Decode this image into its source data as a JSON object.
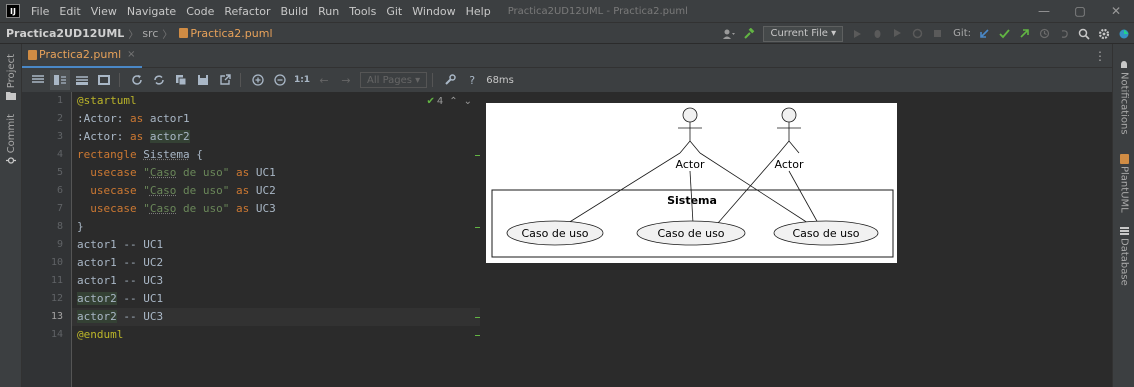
{
  "menubar": {
    "logo": "IJ",
    "items": [
      "File",
      "Edit",
      "View",
      "Navigate",
      "Code",
      "Refactor",
      "Build",
      "Run",
      "Tools",
      "Git",
      "Window",
      "Help"
    ],
    "window_title": "Practica2UD12UML - Practica2.puml",
    "controls": [
      "—",
      "▢",
      "✕"
    ]
  },
  "navbar": {
    "project": "Practica2UD12UML",
    "folder": "src",
    "file": "Practica2.puml",
    "run_config": "Current File",
    "git_label": "Git:"
  },
  "left_strip": {
    "project": "Project",
    "commit": "Commit"
  },
  "right_strip": {
    "notifications": "Notifications",
    "plantuml": "PlantUML",
    "database": "Database"
  },
  "tab": {
    "label": "Practica2.puml",
    "close": "×"
  },
  "toolbar": {
    "zoom_label": "1:1",
    "pages_select": "All Pages",
    "help": "?",
    "time": "68ms"
  },
  "editor": {
    "inspection_count": "4",
    "lines": [
      {
        "n": "1",
        "text": "@startuml"
      },
      {
        "n": "2",
        "text": ":Actor: as actor1"
      },
      {
        "n": "3",
        "text": ":Actor: as actor2"
      },
      {
        "n": "4",
        "text": "rectangle Sistema {"
      },
      {
        "n": "5",
        "text": "  usecase \"Caso de uso\" as UC1"
      },
      {
        "n": "6",
        "text": "  usecase \"Caso de uso\" as UC2"
      },
      {
        "n": "7",
        "text": "  usecase \"Caso de uso\" as UC3"
      },
      {
        "n": "8",
        "text": "}"
      },
      {
        "n": "9",
        "text": "actor1 -- UC1"
      },
      {
        "n": "10",
        "text": "actor1 -- UC2"
      },
      {
        "n": "11",
        "text": "actor1 -- UC3"
      },
      {
        "n": "12",
        "text": "actor2 -- UC1"
      },
      {
        "n": "13",
        "text": "actor2 -- UC3"
      },
      {
        "n": "14",
        "text": "@enduml"
      }
    ],
    "tokens": {
      "kw_as": "as",
      "kw_rectangle": "rectangle",
      "kw_usecase": "usecase",
      "actor_decl": ":Actor:",
      "actor1": "actor1",
      "actor2": "actor2",
      "sistema": "Sistema",
      "brace_open": "{",
      "brace_close": "}",
      "str_open": "\"",
      "str_caso": "Caso",
      "str_rest": " de uso\"",
      "uc1": "UC1",
      "uc2": "UC2",
      "uc3": "UC3",
      "conn": "--",
      "start": "@startuml",
      "end": "@enduml"
    }
  },
  "diagram": {
    "actors": [
      "Actor",
      "Actor"
    ],
    "system": "Sistema",
    "usecases": [
      "Caso de uso",
      "Caso de uso",
      "Caso de uso"
    ]
  },
  "colors": {
    "accent": "#4a88c7",
    "file_orange": "#e8a25a",
    "keyword": "#cc7832",
    "string": "#6a8759",
    "ok_green": "#62b543",
    "usecase_fill": "#f1f1f1"
  }
}
